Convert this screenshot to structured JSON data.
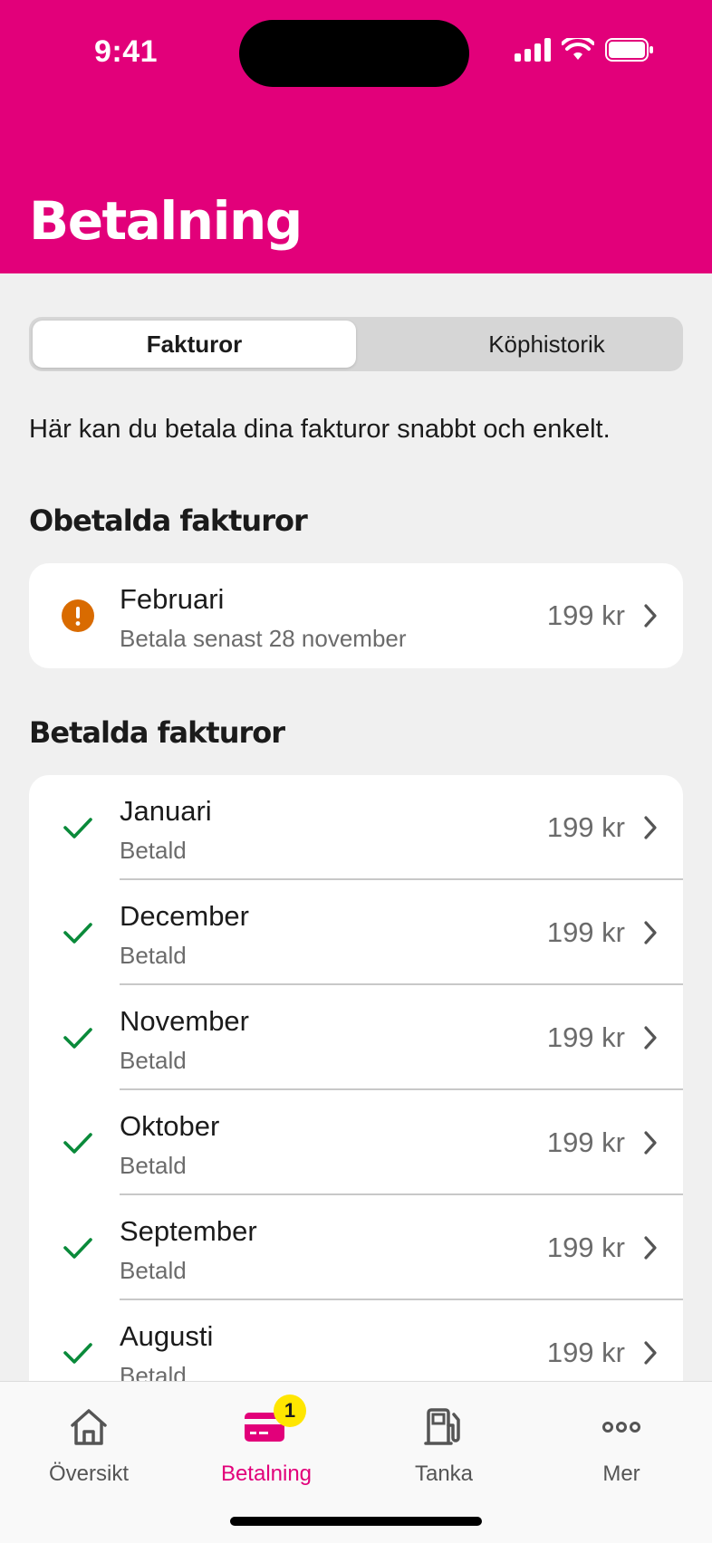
{
  "status_bar": {
    "time": "9:41"
  },
  "header": {
    "title": "Betalning"
  },
  "segments": {
    "active": "Fakturor",
    "inactive": "Köphistorik"
  },
  "intro": "Här kan du betala dina fakturor snabbt och enkelt.",
  "unpaid": {
    "title": "Obetalda fakturor",
    "items": [
      {
        "month": "Februari",
        "subtitle": "Betala senast 28 november",
        "amount": "199 kr"
      }
    ]
  },
  "paid": {
    "title": "Betalda fakturor",
    "items": [
      {
        "month": "Januari",
        "subtitle": "Betald",
        "amount": "199 kr"
      },
      {
        "month": "December",
        "subtitle": "Betald",
        "amount": "199 kr"
      },
      {
        "month": "November",
        "subtitle": "Betald",
        "amount": "199 kr"
      },
      {
        "month": "Oktober",
        "subtitle": "Betald",
        "amount": "199 kr"
      },
      {
        "month": "September",
        "subtitle": "Betald",
        "amount": "199 kr"
      },
      {
        "month": "Augusti",
        "subtitle": "Betald",
        "amount": "199 kr"
      }
    ]
  },
  "tabbar": {
    "items": [
      {
        "label": "Översikt",
        "icon": "home-icon"
      },
      {
        "label": "Betalning",
        "icon": "card-icon",
        "badge": "1"
      },
      {
        "label": "Tanka",
        "icon": "fuel-pump-icon"
      },
      {
        "label": "Mer",
        "icon": "more-icon"
      }
    ]
  },
  "colors": {
    "brand": "#e2007a",
    "warning": "#d96b00",
    "success": "#0a8a3a",
    "badge": "#ffe600"
  }
}
